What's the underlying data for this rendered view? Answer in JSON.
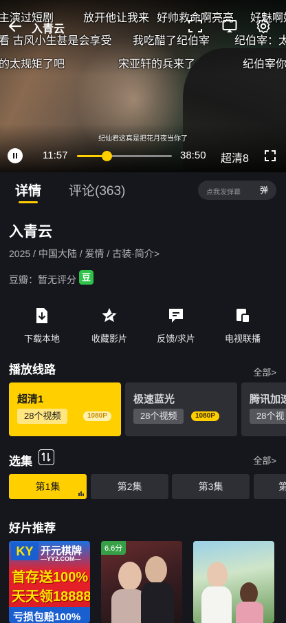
{
  "player": {
    "title": "入青云",
    "danmaku": [
      {
        "text": "主演过短剧"
      },
      {
        "text": "放开他让我来"
      },
      {
        "text": "好帅救命啊亮亮"
      },
      {
        "text": "好魅啊好"
      },
      {
        "text": "看  古风小生甚是会享受"
      },
      {
        "text": "我吃醋了纪伯宰"
      },
      {
        "text": "纪伯宰：太"
      },
      {
        "text": "的太规矩了吧"
      },
      {
        "text": "宋亚轩的兵来了"
      },
      {
        "text": "纪伯宰你"
      }
    ],
    "subtitle": "纪仙君这真是把花月夜当你了",
    "current_time": "11:57",
    "total_time": "38:50",
    "progress": 0.31,
    "quality": "超清8",
    "icons": [
      "back-arrow-icon",
      "pip-icon",
      "cast-icon",
      "settings-gear-icon",
      "pause-icon",
      "fullscreen-icon"
    ]
  },
  "tabs": {
    "details": "详情",
    "comments": "评论(363)"
  },
  "danmaku_input": {
    "placeholder": "点我发弹幕",
    "button": "弹"
  },
  "show": {
    "title": "入青云",
    "meta": "2025 / 中国大陆 / 爱情 / 古装·简介>",
    "douban": "豆瓣：暂无评分",
    "douban_badge": "豆"
  },
  "actions": [
    {
      "label": "下载本地",
      "icon": "download-icon"
    },
    {
      "label": "收藏影片",
      "icon": "star-icon"
    },
    {
      "label": "反馈/求片",
      "icon": "feedback-icon"
    },
    {
      "label": "电视联播",
      "icon": "tv-cast-icon"
    }
  ],
  "lines": {
    "title": "播放线路",
    "all": "全部>",
    "items": [
      {
        "name": "超清1",
        "count": "28个视频",
        "res": "1080P",
        "active": true
      },
      {
        "name": "极速蓝光",
        "count": "28个视频",
        "res": "1080P",
        "active": false
      },
      {
        "name": "腾讯加速",
        "count": "28个视",
        "res": "",
        "active": false
      }
    ]
  },
  "episodes": {
    "title": "选集",
    "all": "全部>",
    "items": [
      {
        "label": "第1集",
        "active": true
      },
      {
        "label": "第2集",
        "active": false
      },
      {
        "label": "第3集",
        "active": false
      },
      {
        "label": "第",
        "active": false
      }
    ]
  },
  "recommend": {
    "title": "好片推荐",
    "posters": [
      {
        "ad_brand": "开元棋牌",
        "ad_logo": "KY",
        "ad_site": "—YY2.COM—",
        "ad_line1": "首存送100%",
        "ad_line2": "天天领18888",
        "ad_line3": "亏损包赔100%"
      },
      {
        "score": "6.6分"
      },
      {}
    ]
  },
  "colors": {
    "accent": "#ffcf00",
    "background": "#16171c",
    "card": "#2e2f35",
    "douban_green": "#2fc24a"
  }
}
